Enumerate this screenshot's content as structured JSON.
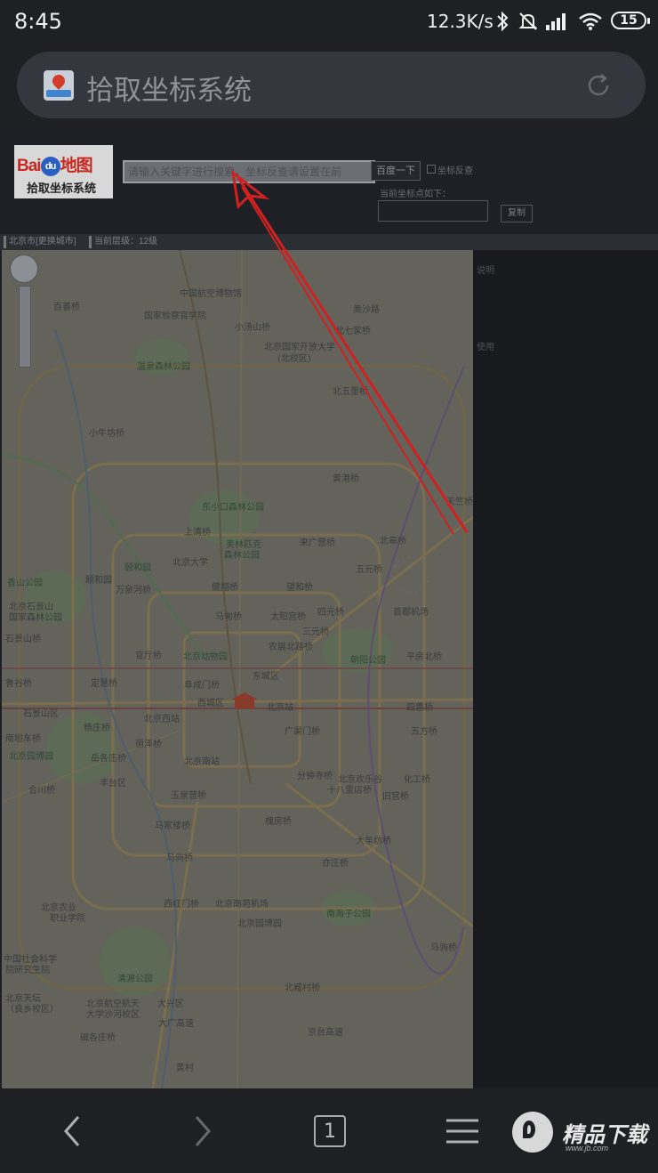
{
  "status_bar": {
    "time": "8:45",
    "net_speed": "12.3K/s",
    "battery_level": "15",
    "icons": [
      "bluetooth-icon",
      "mute-icon",
      "signal-icon",
      "wifi-icon",
      "battery-icon"
    ]
  },
  "address_bar": {
    "page_title": "拾取坐标系统",
    "site_icon": "map-pin-icon",
    "reload_icon": "reload-icon"
  },
  "header": {
    "logo_brand_left": "Bai",
    "logo_brand_du": "du",
    "logo_brand_right": "地图",
    "logo_subtitle": "拾取坐标系统",
    "keyword_placeholder": "请输入关键字进行搜索，坐标反查请设置在前",
    "search_button": "百度一下",
    "reverse_lookup_label": "坐标反查",
    "coord_label": "当前坐标点如下：",
    "copy_button": "复制"
  },
  "breadcrumbs": [
    "北京市[更换城市]",
    "当前层级：12级"
  ],
  "map": {
    "labels": [
      {
        "text": "中国航空博物馆",
        "g": false
      },
      {
        "text": "国家检察官学院",
        "g": false
      },
      {
        "text": "小汤山桥",
        "g": false
      },
      {
        "text": "北京国家开放大学",
        "g": false
      },
      {
        "text": "(北校区)",
        "g": false
      },
      {
        "text": "百善桥",
        "g": false
      },
      {
        "text": "奥沙路",
        "g": false
      },
      {
        "text": "北七家桥",
        "g": false
      },
      {
        "text": "温泉森林公园",
        "g": true
      },
      {
        "text": "北五里桥",
        "g": false
      },
      {
        "text": "小牛坊桥",
        "g": false
      },
      {
        "text": "黄港桥",
        "g": false
      },
      {
        "text": "东小口森林公园",
        "g": true
      },
      {
        "text": "天竺桥",
        "g": false
      },
      {
        "text": "上清桥",
        "g": false
      },
      {
        "text": "奥林匹克",
        "g": true
      },
      {
        "text": "森林公园",
        "g": true
      },
      {
        "text": "来广营桥",
        "g": false
      },
      {
        "text": "北皋桥",
        "g": false
      },
      {
        "text": "颐和园",
        "g": true
      },
      {
        "text": "北京大学",
        "g": false
      },
      {
        "text": "五元桥",
        "g": false
      },
      {
        "text": "香山公园",
        "g": true
      },
      {
        "text": "颐和园",
        "g": false
      },
      {
        "text": "万泉河桥",
        "g": false
      },
      {
        "text": "健翔桥",
        "g": false
      },
      {
        "text": "望和桥",
        "g": false
      },
      {
        "text": "北京石景山",
        "g": false
      },
      {
        "text": "国家森林公园",
        "g": false
      },
      {
        "text": "马甸桥",
        "g": false
      },
      {
        "text": "太阳宫桥",
        "g": false
      },
      {
        "text": "四元桥",
        "g": false
      },
      {
        "text": "首都机场",
        "g": false
      },
      {
        "text": "三元桥",
        "g": false
      },
      {
        "text": "石景山桥",
        "g": false
      },
      {
        "text": "农展北路桥",
        "g": false
      },
      {
        "text": "平房北桥",
        "g": false
      },
      {
        "text": "官厅桥",
        "g": false
      },
      {
        "text": "北京动物园",
        "g": true
      },
      {
        "text": "朝阳公园",
        "g": true
      },
      {
        "text": "鲁谷桥",
        "g": false
      },
      {
        "text": "定慧桥",
        "g": false
      },
      {
        "text": "阜成门桥",
        "g": false
      },
      {
        "text": "西城区",
        "g": false
      },
      {
        "text": "东城区",
        "g": false
      },
      {
        "text": "石景山区",
        "g": false
      },
      {
        "text": "北京西站",
        "g": false
      },
      {
        "text": "北京站",
        "g": false
      },
      {
        "text": "四惠桥",
        "g": false
      },
      {
        "text": "杨庄桥",
        "g": false
      },
      {
        "text": "丽泽桥",
        "g": false
      },
      {
        "text": "广渠门桥",
        "g": false
      },
      {
        "text": "五方桥",
        "g": false
      },
      {
        "text": "南坦车桥",
        "g": false
      },
      {
        "text": "北京园博园",
        "g": true
      },
      {
        "text": "岳各庄桥",
        "g": false
      },
      {
        "text": "北京南站",
        "g": false
      },
      {
        "text": "分钟寺桥",
        "g": false
      },
      {
        "text": "丰台区",
        "g": false
      },
      {
        "text": "北京欢乐谷",
        "g": false
      },
      {
        "text": "化工桥",
        "g": false
      },
      {
        "text": "合川桥",
        "g": false
      },
      {
        "text": "玉泉营桥",
        "g": false
      },
      {
        "text": "十八里店桥",
        "g": false
      },
      {
        "text": "旧宫桥",
        "g": false
      },
      {
        "text": "马家楼桥",
        "g": false
      },
      {
        "text": "槐房桥",
        "g": false
      },
      {
        "text": "大羊坊桥",
        "g": false
      },
      {
        "text": "马驹桥",
        "g": false
      },
      {
        "text": "北京南苑机场",
        "g": false
      },
      {
        "text": "亦庄桥",
        "g": false
      },
      {
        "text": "南海子公园",
        "g": true
      },
      {
        "text": "北京农业",
        "g": false
      },
      {
        "text": "职业学院",
        "g": false
      },
      {
        "text": "西红门桥",
        "g": false
      },
      {
        "text": "马驹桥",
        "g": false
      },
      {
        "text": "中国社会科学",
        "g": false
      },
      {
        "text": "院研究生院",
        "g": false
      },
      {
        "text": "清源公园",
        "g": true
      },
      {
        "text": "北京天坛",
        "g": false
      },
      {
        "text": "北京园博园",
        "g": false
      },
      {
        "text": "（良乡校区）",
        "g": false
      },
      {
        "text": "北京航空航天",
        "g": false
      },
      {
        "text": "大学沙河校区",
        "g": false
      },
      {
        "text": "北臧村桥",
        "g": false
      },
      {
        "text": "京台高速",
        "g": false
      },
      {
        "text": "黄村",
        "g": false
      },
      {
        "text": "大兴区",
        "g": false
      },
      {
        "text": "磁各庄桥",
        "g": false
      },
      {
        "text": "大广高速",
        "g": false
      }
    ]
  },
  "side_panel": {
    "labels": [
      "说明",
      "使用"
    ]
  },
  "bottom_nav": {
    "tabs_count": "1",
    "watermark_text": "精品下载",
    "watermark_url": "www.jb.com"
  }
}
